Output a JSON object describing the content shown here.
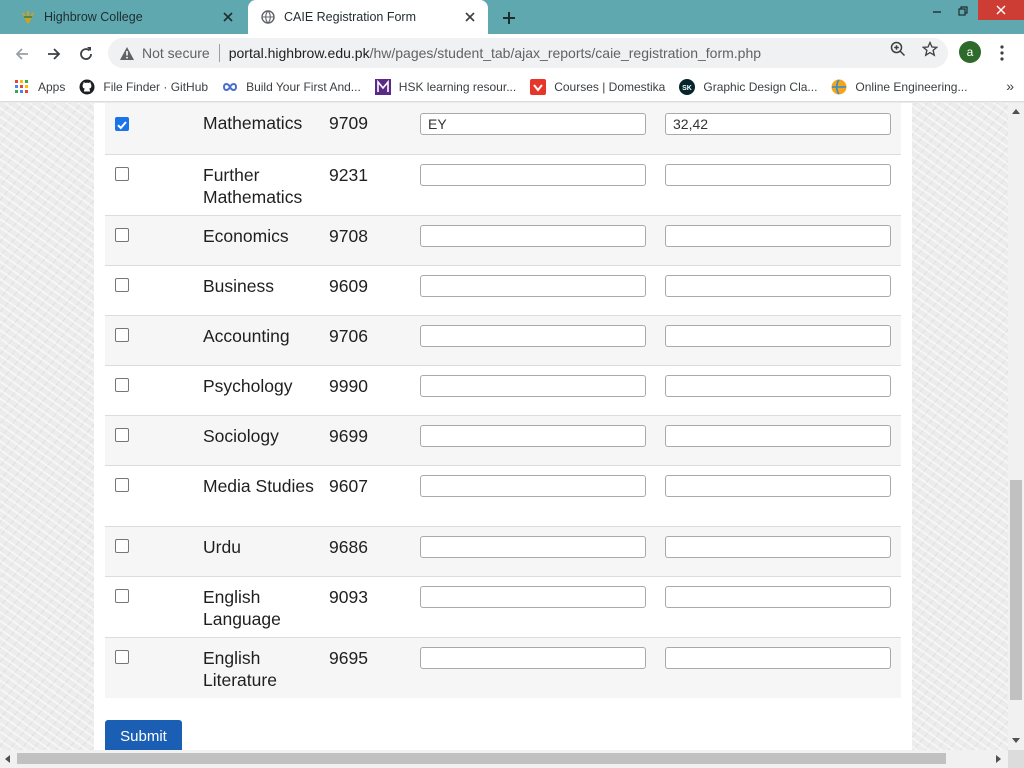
{
  "browser": {
    "tabs": [
      {
        "title": "Highbrow College",
        "active": false
      },
      {
        "title": "CAIE Registration Form",
        "active": true
      }
    ],
    "address": {
      "security": "Not secure",
      "host": "portal.highbrow.edu.pk",
      "path": "/hw/pages/student_tab/ajax_reports/caie_registration_form.php"
    },
    "profile_initial": "a",
    "bookmarks": [
      {
        "label": "Apps",
        "icon": "apps-grid-icon"
      },
      {
        "label": "File Finder · GitHub",
        "icon": "github-icon"
      },
      {
        "label": "Build Your First And...",
        "icon": "infinity-icon"
      },
      {
        "label": "HSK learning resour...",
        "icon": "m-logo-icon"
      },
      {
        "label": "Courses | Domestika",
        "icon": "domestika-icon"
      },
      {
        "label": "Graphic Design Cla...",
        "icon": "sk-icon"
      },
      {
        "label": "Online Engineering...",
        "icon": "globe-icon"
      }
    ],
    "bookmarks_overflow": "»"
  },
  "form": {
    "rows": [
      {
        "checked": true,
        "subject": "Mathematics",
        "code": "9709",
        "field_a": "EY",
        "field_b": "32,42"
      },
      {
        "checked": false,
        "subject": "Further Mathematics",
        "code": "9231",
        "field_a": "",
        "field_b": ""
      },
      {
        "checked": false,
        "subject": "Economics",
        "code": "9708",
        "field_a": "",
        "field_b": ""
      },
      {
        "checked": false,
        "subject": "Business",
        "code": "9609",
        "field_a": "",
        "field_b": ""
      },
      {
        "checked": false,
        "subject": "Accounting",
        "code": "9706",
        "field_a": "",
        "field_b": ""
      },
      {
        "checked": false,
        "subject": "Psychology",
        "code": "9990",
        "field_a": "",
        "field_b": ""
      },
      {
        "checked": false,
        "subject": "Sociology",
        "code": "9699",
        "field_a": "",
        "field_b": ""
      },
      {
        "checked": false,
        "subject": "Media Studies",
        "code": "9607",
        "field_a": "",
        "field_b": ""
      },
      {
        "checked": false,
        "subject": "Urdu",
        "code": "9686",
        "field_a": "",
        "field_b": ""
      },
      {
        "checked": false,
        "subject": "English Language",
        "code": "9093",
        "field_a": "",
        "field_b": ""
      },
      {
        "checked": false,
        "subject": "English Literature",
        "code": "9695",
        "field_a": "",
        "field_b": ""
      }
    ],
    "submit_label": "Submit"
  },
  "colors": {
    "tabstrip": "#5fa8b0",
    "checkbox_checked": "#1a73e8",
    "submit_button": "#1a5fb4",
    "close_button": "#cd3d34"
  }
}
